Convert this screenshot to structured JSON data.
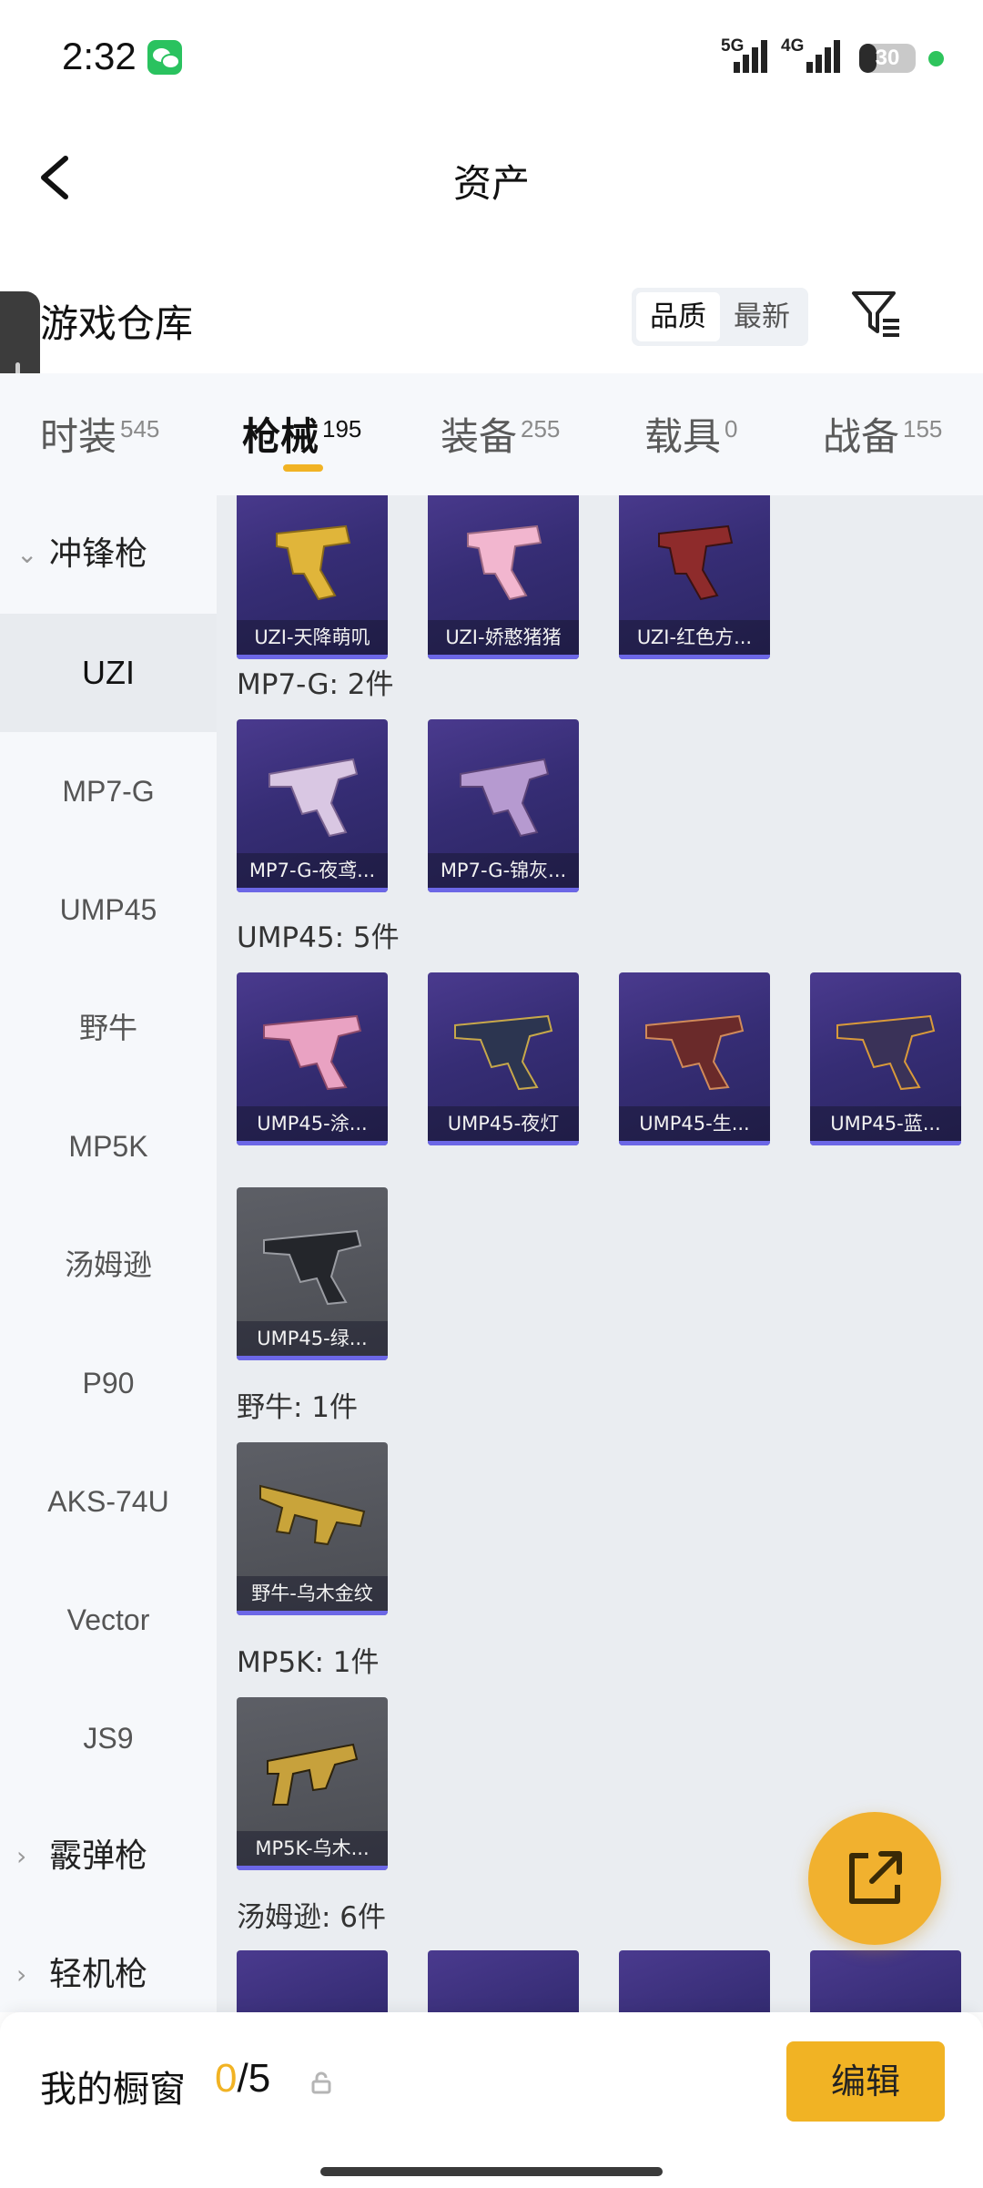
{
  "status_bar": {
    "time": "2:32",
    "network_1": "5G",
    "network_2": "4G",
    "battery": "30",
    "battery_level": 0.3
  },
  "header": {
    "title": "资产",
    "back_icon": "chevron-left-icon"
  },
  "warehouse": {
    "title": "游戏仓库",
    "sort_options": [
      "品质",
      "最新"
    ],
    "sort_selected": "品质",
    "filter_icon": "filter-list-icon"
  },
  "tabs": [
    {
      "label": "时装",
      "count": "545"
    },
    {
      "label": "枪械",
      "count": "195",
      "active": true
    },
    {
      "label": "装备",
      "count": "255"
    },
    {
      "label": "载具",
      "count": "0"
    },
    {
      "label": "战备",
      "count": "155"
    }
  ],
  "sidebar": {
    "group_expanded": "冲锋枪",
    "items": [
      "UZI",
      "MP7-G",
      "UMP45",
      "野牛",
      "MP5K",
      "汤姆逊",
      "P90",
      "AKS-74U",
      "Vector",
      "JS9"
    ],
    "selected": "UZI",
    "groups_collapsed": [
      "霰弹枪",
      "轻机枪"
    ]
  },
  "content": {
    "uzi_items": [
      "UZI-天降萌叽",
      "UZI-娇憨猪猪",
      "UZI-红色方..."
    ],
    "mp7_header": "MP7-G: 2件",
    "mp7_items": [
      "MP7-G-夜鸢...",
      "MP7-G-锦灰..."
    ],
    "ump45_header": "UMP45: 5件",
    "ump45_items": [
      "UMP45-涂...",
      "UMP45-夜灯",
      "UMP45-生...",
      "UMP45-蓝...",
      "UMP45-绿..."
    ],
    "bison_header": "野牛: 1件",
    "bison_items": [
      "野牛-乌木金纹"
    ],
    "mp5k_header": "MP5K: 1件",
    "mp5k_items": [
      "MP5K-乌木..."
    ],
    "thompson_header": "汤姆逊: 6件"
  },
  "fab_icon": "share-external-icon",
  "showcase": {
    "label": "我的橱窗",
    "current": "0",
    "total": "/5",
    "lock_icon": "lock-icon",
    "edit_label": "编辑"
  },
  "colors": {
    "accent": "#f1b324",
    "card_purple": "#3a2f7c",
    "card_gray": "#55575d"
  }
}
